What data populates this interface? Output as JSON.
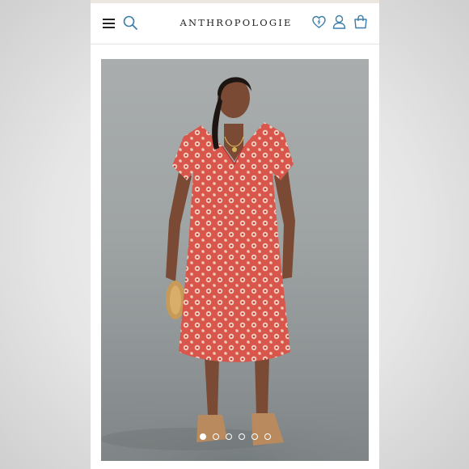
{
  "header": {
    "brand": "ANTHROPOLOGIE",
    "icons": [
      "menu-icon",
      "search-icon",
      "wishlist-heart-icon",
      "account-icon",
      "shopping-bag-icon"
    ]
  },
  "product_image": {
    "carousel": {
      "total_slides": 6,
      "active_slide": 1
    }
  },
  "colors": {
    "brand_icon": "#3a7ea8",
    "text": "#222222",
    "dress_red": "#d8564b",
    "dress_cream": "#f1d6c6"
  }
}
